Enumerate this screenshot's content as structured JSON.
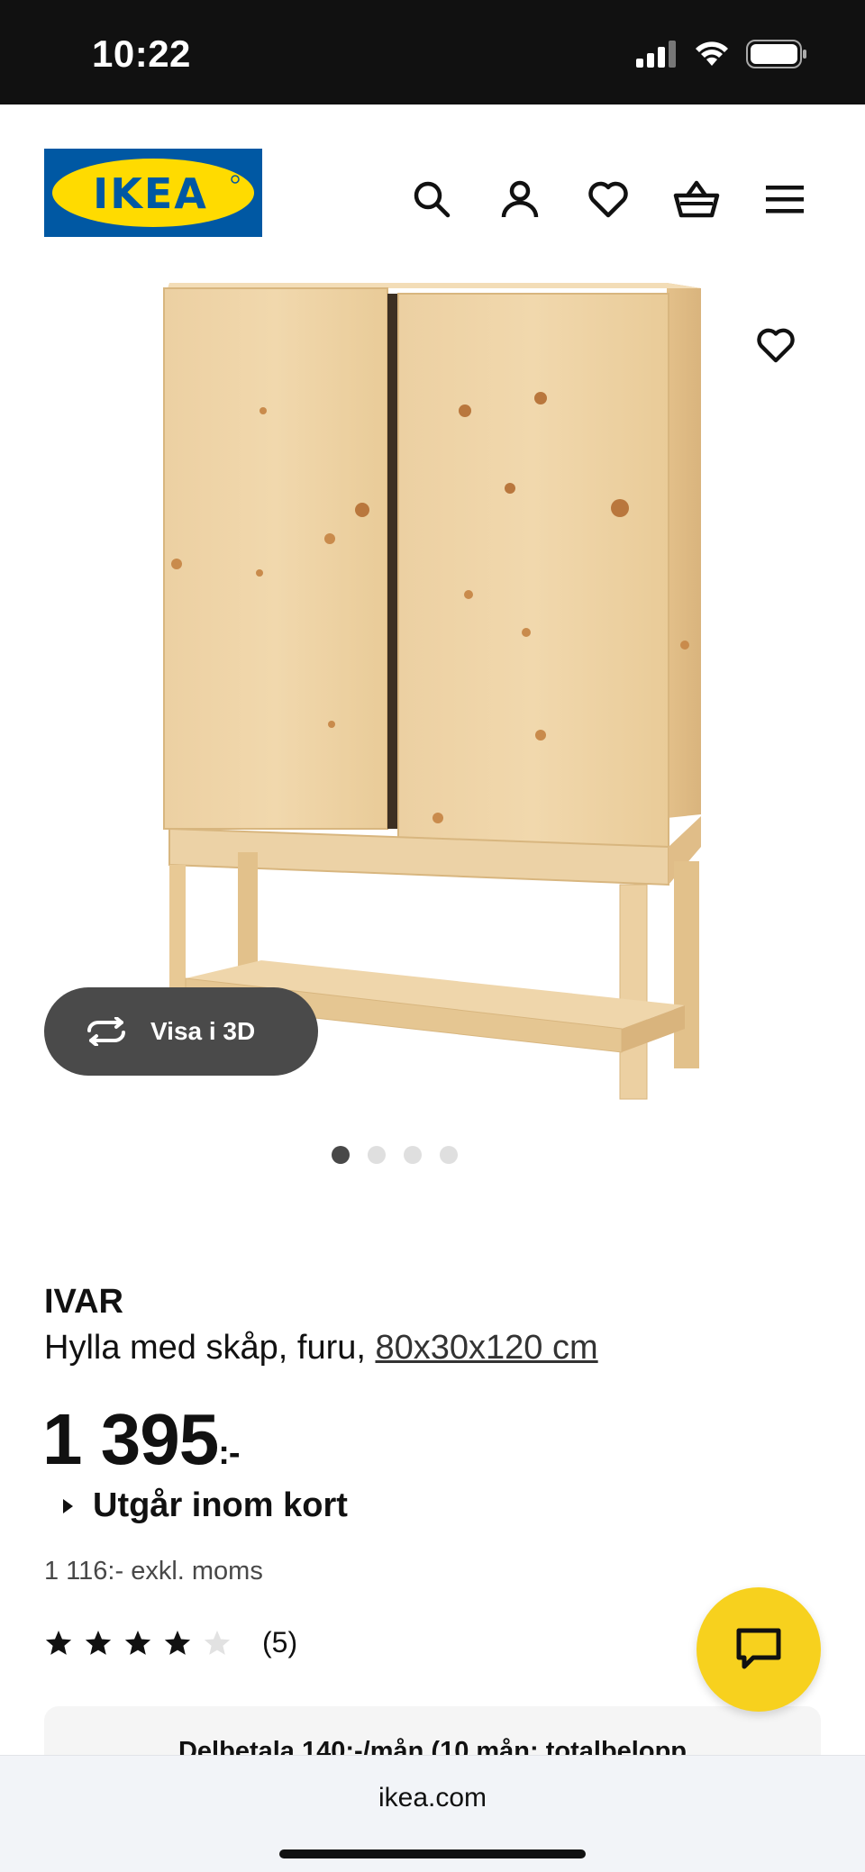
{
  "status_bar": {
    "time": "10:22"
  },
  "header": {
    "brand": "IKEA"
  },
  "gallery": {
    "view_3d_label": "Visa i 3D",
    "dots_count": 4,
    "active_index": 0
  },
  "product": {
    "name": "IVAR",
    "description": "Hylla med skåp, furu,",
    "size_link": "80x30x120 cm",
    "price": "1 395",
    "price_suffix": ":-",
    "stock_status": "Utgår inom kort",
    "price_excl_vat": "1 116:- exkl. moms",
    "rating_value": 4,
    "rating_max": 5,
    "review_count": "(5)"
  },
  "installment": {
    "text": "Delbetala 140:-/mån (10 mån: totalbelopp"
  },
  "browser": {
    "url": "ikea.com"
  },
  "colors": {
    "brand_blue": "#0058a3",
    "brand_yellow": "#ffdb00",
    "chat_yellow": "#f7d11e"
  }
}
